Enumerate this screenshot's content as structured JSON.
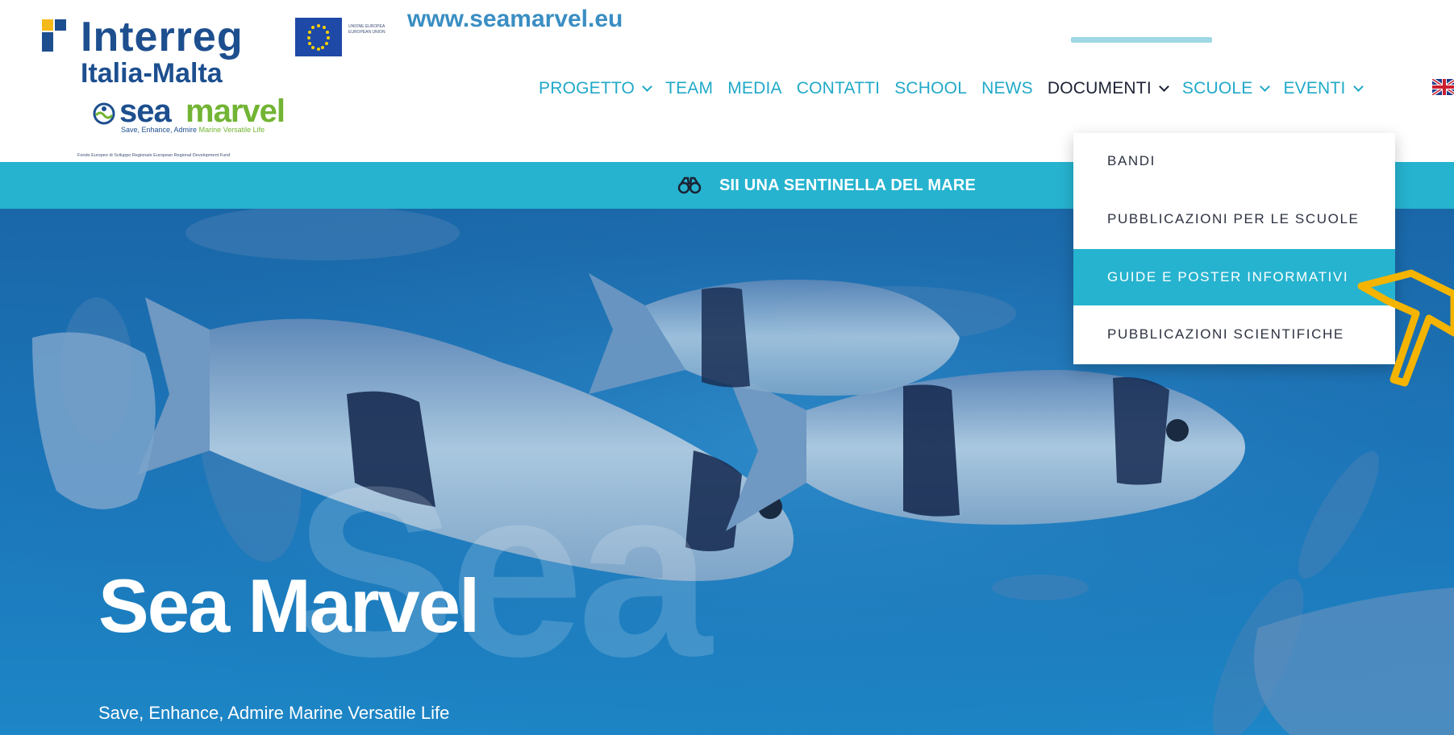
{
  "site": {
    "url": "www.seamarvel.eu"
  },
  "logo": {
    "program": "Interreg",
    "region": "Italia-Malta",
    "eu_caption": "Unione Europea European Union",
    "brand_sea": "sea",
    "brand_marvel": "marvel",
    "tagline_a": "Save, Enhance, Admire",
    "tagline_b": "Marine Versatile Life",
    "fund": "Fondo Europeo di Sviluppo Regionale European Regional Development Fund"
  },
  "nav": {
    "items": [
      {
        "label": "PROGETTO",
        "dropdown": true
      },
      {
        "label": "TEAM",
        "dropdown": false
      },
      {
        "label": "MEDIA",
        "dropdown": false
      },
      {
        "label": "CONTATTI",
        "dropdown": false
      },
      {
        "label": "SCHOOL",
        "dropdown": false
      },
      {
        "label": "NEWS",
        "dropdown": false
      },
      {
        "label": "DOCUMENTI",
        "dropdown": true,
        "active": true
      },
      {
        "label": "SCUOLE",
        "dropdown": true
      },
      {
        "label": "EVENTI",
        "dropdown": true
      }
    ],
    "language_icon": "uk-flag-icon"
  },
  "banner": {
    "icon": "binoculars-icon",
    "text": "SII UNA SENTINELLA DEL MARE"
  },
  "dropdown": {
    "items": [
      {
        "label": "BANDI",
        "active": false
      },
      {
        "label": "PUBBLICAZIONI PER LE SCUOLE",
        "active": false
      },
      {
        "label": "GUIDE E POSTER INFORMATIVI",
        "active": true
      },
      {
        "label": "PUBBLICAZIONI SCIENTIFICHE",
        "active": false
      }
    ]
  },
  "hero": {
    "title": "Sea Marvel",
    "watermark": "Sea",
    "subtitle": "Save, Enhance, Admire Marine Versatile Life"
  },
  "colors": {
    "accent": "#26b3cf",
    "nav_text": "#21a9c8",
    "nav_active": "#1b2233",
    "brand_blue": "#1d4f8f",
    "brand_green": "#72b433",
    "annotation": "#f4b400"
  }
}
